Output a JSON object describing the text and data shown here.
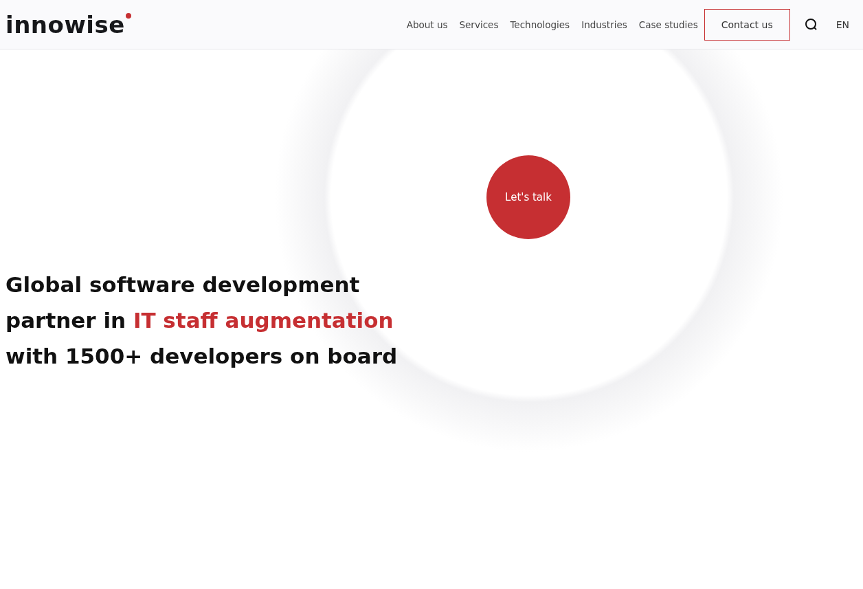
{
  "header": {
    "logo": "innowise",
    "nav": [
      {
        "label": "About us"
      },
      {
        "label": "Services"
      },
      {
        "label": "Technologies"
      },
      {
        "label": "Industries"
      },
      {
        "label": "Case studies"
      }
    ],
    "contact_button": "Contact us",
    "language": "EN"
  },
  "hero": {
    "cta_button": "Let's talk",
    "headline": [
      [
        {
          "text": "Global software development",
          "accent": false
        }
      ],
      [
        {
          "text": "partner in ",
          "accent": false
        },
        {
          "text": "IT staff augmentation",
          "accent": true
        }
      ],
      [
        {
          "text": "with 1500+ developers on board",
          "accent": false
        }
      ]
    ]
  }
}
